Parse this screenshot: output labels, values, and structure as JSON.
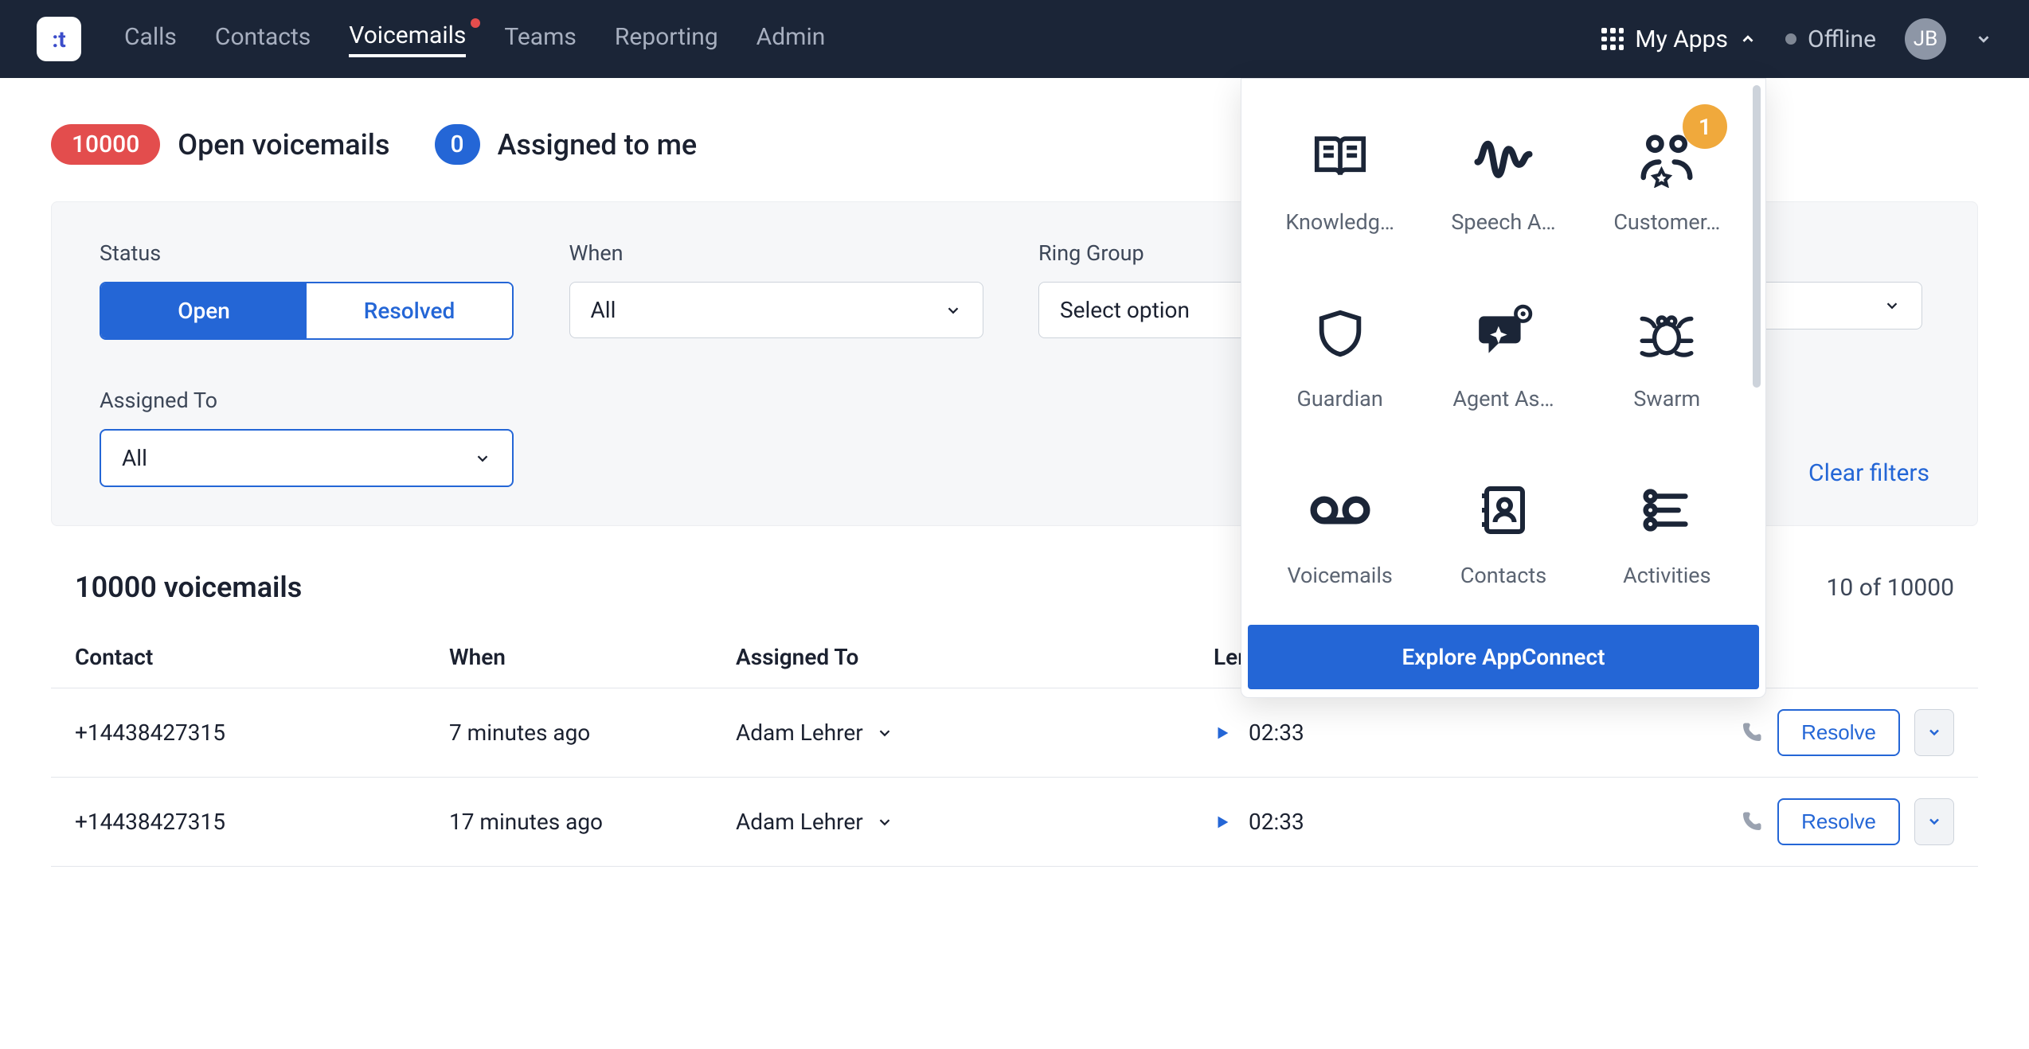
{
  "nav": {
    "links": [
      "Calls",
      "Contacts",
      "Voicemails",
      "Teams",
      "Reporting",
      "Admin"
    ],
    "active_index": 2,
    "my_apps_label": "My Apps",
    "status_label": "Offline",
    "avatar_initials": "JB",
    "logo_text": ":t"
  },
  "header": {
    "open_count": "10000",
    "open_label": "Open voicemails",
    "assigned_count": "0",
    "assigned_label": "Assigned to me"
  },
  "filters": {
    "status_label": "Status",
    "status_open": "Open",
    "status_resolved": "Resolved",
    "when_label": "When",
    "when_value": "All",
    "ring_label": "Ring Group",
    "ring_value": "Select option",
    "extra_value": "",
    "assigned_label": "Assigned To",
    "assigned_value": "All",
    "clear_label": "Clear filters"
  },
  "table": {
    "title": "10000 voicemails",
    "pager_label": "10 of 10000",
    "cols": {
      "contact": "Contact",
      "when": "When",
      "assigned": "Assigned To",
      "length": "Length"
    },
    "rows": [
      {
        "contact": "+14438427315",
        "when": "7 minutes ago",
        "assigned": "Adam Lehrer",
        "length": "02:33",
        "resolve": "Resolve"
      },
      {
        "contact": "+14438427315",
        "when": "17 minutes ago",
        "assigned": "Adam Lehrer",
        "length": "02:33",
        "resolve": "Resolve"
      }
    ]
  },
  "apps": {
    "items": [
      {
        "label": "Knowledg…",
        "badge": null
      },
      {
        "label": "Speech A…",
        "badge": null
      },
      {
        "label": "Customer…",
        "badge": "1"
      },
      {
        "label": "Guardian",
        "badge": null
      },
      {
        "label": "Agent As…",
        "badge": null
      },
      {
        "label": "Swarm",
        "badge": null
      },
      {
        "label": "Voicemails",
        "badge": null
      },
      {
        "label": "Contacts",
        "badge": null
      },
      {
        "label": "Activities",
        "badge": null
      }
    ],
    "cta_label": "Explore AppConnect"
  },
  "colors": {
    "accent": "#2466d6",
    "danger": "#e34d4d",
    "navy": "#1b2537",
    "badge": "#f0a93c"
  }
}
